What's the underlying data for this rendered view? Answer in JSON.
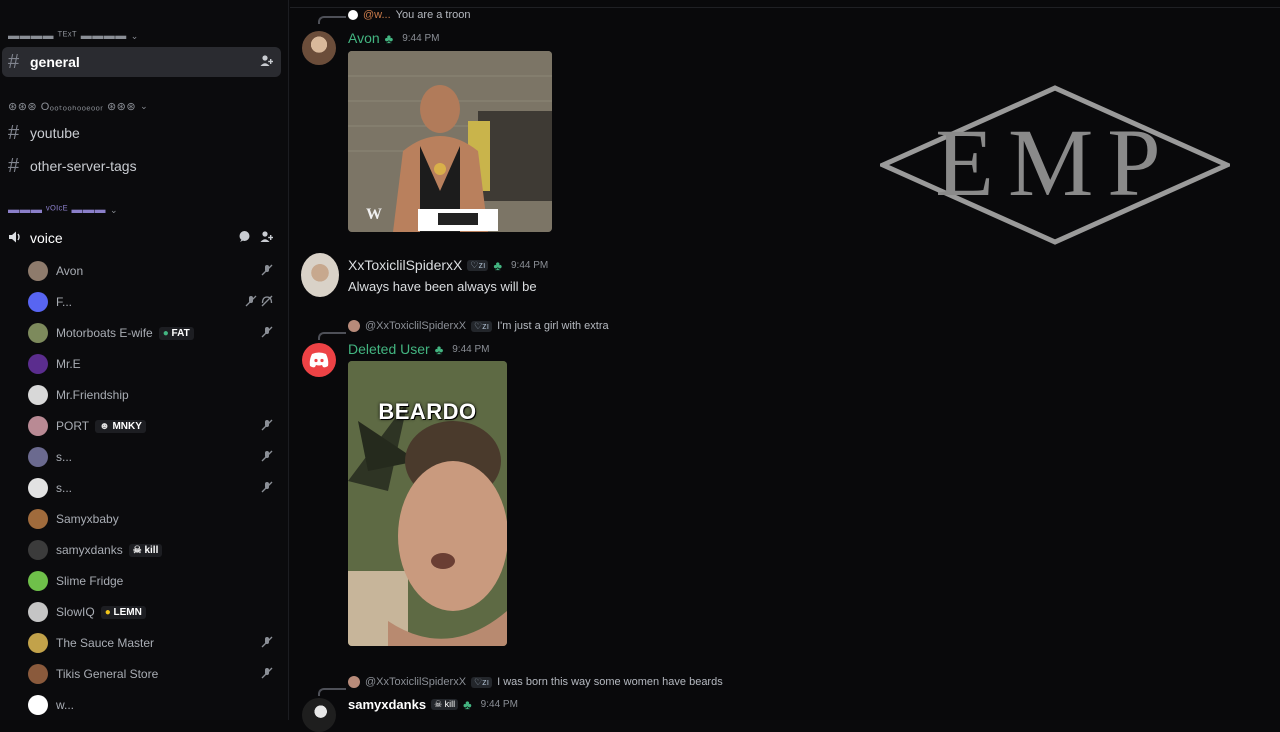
{
  "sidebar": {
    "text_category": "▬▬▬▬ ᵀᴱˣᵀ ▬▬▬▬",
    "channels_a": [
      {
        "label": "general",
        "active": true
      }
    ],
    "deco_category": "⊛⊛⊛ Oₒₒₜₒₒₕₒₒₑₒₒᵣ ⊛⊛⊛",
    "channels_b": [
      {
        "label": "youtube"
      },
      {
        "label": "other-server-tags"
      }
    ],
    "voice_category": "▬▬▬ ᵛᴼᴵᶜᴱ ▬▬▬",
    "voice_channel": "voice",
    "voice_users": [
      {
        "name": "Avon",
        "tag": "",
        "muted": true,
        "deafened": false,
        "color": "#8e7b6c"
      },
      {
        "name": "F...",
        "tag": "",
        "muted": true,
        "deafened": true,
        "color": "#5865f2"
      },
      {
        "name": "Motorboats E-wife",
        "tag": "FAT",
        "muted": true,
        "deafened": false,
        "color": "#7d8a5c"
      },
      {
        "name": "Mr.E",
        "tag": "",
        "muted": false,
        "deafened": false,
        "color": "#5b2d8e"
      },
      {
        "name": "Mr.Friendship",
        "tag": "",
        "muted": false,
        "deafened": false,
        "color": "#d8d8d8"
      },
      {
        "name": "PORT",
        "tag": "MNKY",
        "muted": true,
        "deafened": false,
        "color": "#b98a94"
      },
      {
        "name": "s...",
        "tag": "",
        "muted": true,
        "deafened": false,
        "color": "#6b6a8f"
      },
      {
        "name": "s...",
        "tag": "",
        "muted": true,
        "deafened": false,
        "color": "#e2e2e2"
      },
      {
        "name": "Samyxbaby",
        "tag": "",
        "muted": false,
        "deafened": false,
        "color": "#a06b3c"
      },
      {
        "name": "samyxdanks",
        "tag": "kill",
        "muted": false,
        "deafened": false,
        "color": "#3b3b3b"
      },
      {
        "name": "Slime Fridge",
        "tag": "",
        "muted": false,
        "deafened": false,
        "color": "#6fc04a"
      },
      {
        "name": "SlowIQ",
        "tag": "LEMN",
        "muted": false,
        "deafened": false,
        "color": "#c5c5c5"
      },
      {
        "name": "The Sauce Master",
        "tag": "",
        "muted": true,
        "deafened": false,
        "color": "#c2a24a"
      },
      {
        "name": "Tikis General Store",
        "tag": "",
        "muted": true,
        "deafened": false,
        "color": "#8a5a3c"
      },
      {
        "name": "w...",
        "tag": "",
        "muted": false,
        "deafened": false,
        "color": "#ffffff"
      }
    ]
  },
  "messages": [
    {
      "reply_user": "@w...",
      "reply_text": "You are a troon",
      "author": "Avon",
      "author_color": "#43b581",
      "time": "9:44 PM",
      "attachment": "gif"
    },
    {
      "author": "XxToxiclilSpiderxX",
      "author_color": "#dbdee1",
      "badge": "♡zı",
      "time": "9:44 PM",
      "text": "Always have been always will be"
    },
    {
      "reply_user": "@XxToxiclilSpiderxX",
      "reply_badge": "♡zı",
      "reply_text": "I'm just a girl with extra",
      "author": "Deleted User",
      "author_color": "#43b581",
      "time": "9:44 PM",
      "gif_caption": "BEARDO"
    },
    {
      "reply_user": "@XxToxiclilSpiderxX",
      "reply_badge": "♡zı",
      "reply_text": "I was born this way some women have beards",
      "author": "samyxdanks",
      "author_badge": "kill",
      "author_color": "#ffffff",
      "time": "9:44 PM"
    }
  ],
  "watermark": {
    "text": "EMP"
  },
  "colors": {
    "accent_green": "#43b581",
    "discord_red": "#ed4245"
  }
}
